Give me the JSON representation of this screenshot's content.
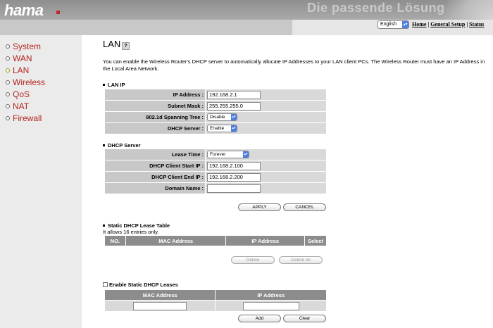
{
  "header": {
    "logo": "hama",
    "tagline": "Die passende Lösung"
  },
  "topbar": {
    "language": "English",
    "links": [
      "Home",
      "General Setup",
      "Status"
    ]
  },
  "sidebar": {
    "items": [
      {
        "label": "System"
      },
      {
        "label": "WAN"
      },
      {
        "label": "LAN",
        "active": true
      },
      {
        "label": "Wireless"
      },
      {
        "label": "QoS"
      },
      {
        "label": "NAT"
      },
      {
        "label": "Firewall"
      }
    ]
  },
  "main": {
    "title": "LAN",
    "description": "You can enable the Wireless Router's DHCP server to automatically allocate IP Addresses to your LAN client PCs. The Wireless Router must have an IP Address in the Local Area Network.",
    "lan_ip": {
      "heading": "LAN IP",
      "ip_address_label": "IP Address :",
      "ip_address": "192.168.2.1",
      "subnet_mask_label": "Subnet Mask :",
      "subnet_mask": "255.255.255.0",
      "spanning_tree_label": "802.1d Spanning Tree :",
      "spanning_tree": "Disable",
      "dhcp_server_label": "DHCP Server :",
      "dhcp_server": "Enable"
    },
    "dhcp_server": {
      "heading": "DHCP Server",
      "lease_time_label": "Lease Time :",
      "lease_time": "Forever",
      "start_ip_label": "DHCP Client Start IP :",
      "start_ip": "192.168.2.100",
      "end_ip_label": "DHCP Client End IP :",
      "end_ip": "192.168.2.200",
      "domain_name_label": "Domain Name :",
      "domain_name": ""
    },
    "buttons": {
      "apply": "APPLY",
      "cancel": "CANCEL"
    },
    "static_table": {
      "heading": "Static DHCP Lease Table",
      "note": "It allows 16 entries only.",
      "columns": [
        "NO.",
        "MAC Address",
        "IP Address",
        "Select"
      ],
      "delete": "Delete",
      "delete_all": "Delete All"
    },
    "static_leases": {
      "checkbox_label": "Enable Static DHCP Leases",
      "columns": [
        "MAC Address",
        "IP Address"
      ],
      "mac_value": "",
      "ip_value": "",
      "add": "Add",
      "clear": "Clear"
    }
  },
  "colors": {
    "nav_text": "#b3261e",
    "label_cell": "#c8c8c8",
    "value_cell": "#d9d9d9",
    "table_header": "#8c8c8c",
    "select_arrow": "#4f7fe0"
  }
}
